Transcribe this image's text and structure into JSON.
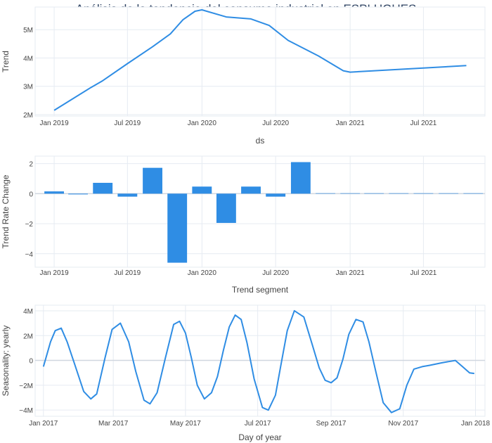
{
  "title": "Análisis de la tendencia del consumo industrial en ESPLUGUES",
  "colors": {
    "line": "#2f8de4",
    "bar": "#2f8de4",
    "grid": "#e6ebf2",
    "zeroline": "#d0d6df"
  },
  "chart_data": [
    {
      "type": "line",
      "name": "trend",
      "xlabel": "ds",
      "ylabel": "Trend",
      "x_ticks": [
        "Jan 2019",
        "Jul 2019",
        "Jan 2020",
        "Jul 2020",
        "Jan 2021",
        "Jul 2021"
      ],
      "y_ticks": [
        "2M",
        "3M",
        "4M",
        "5M"
      ],
      "xlim": [
        "2018-11-15",
        "2021-11-30"
      ],
      "ylim": [
        1950000,
        5800000
      ],
      "x": [
        "2019-01-01",
        "2019-04-01",
        "2019-05-01",
        "2019-07-01",
        "2019-09-01",
        "2019-10-15",
        "2019-11-15",
        "2019-12-15",
        "2020-01-01",
        "2020-03-01",
        "2020-05-01",
        "2020-06-15",
        "2020-08-01",
        "2020-10-15",
        "2020-12-15",
        "2021-01-01",
        "2021-10-15"
      ],
      "y": [
        2150000,
        2950000,
        3200000,
        3800000,
        4400000,
        4850000,
        5350000,
        5650000,
        5700000,
        5450000,
        5380000,
        5150000,
        4620000,
        4070000,
        3550000,
        3500000,
        3730000
      ],
      "grid": true
    },
    {
      "type": "bar",
      "name": "trend-rate-change",
      "xlabel": "Trend segment",
      "ylabel": "Trend Rate Change",
      "x_ticks": [
        "Jan 2019",
        "Jul 2019",
        "Jan 2020",
        "Jul 2020",
        "Jan 2021",
        "Jul 2021"
      ],
      "y_ticks": [
        "2",
        "0",
        "−2",
        "−4"
      ],
      "xlim": [
        "2018-11-15",
        "2021-11-30"
      ],
      "ylim": [
        -4.9,
        2.5
      ],
      "x": [
        "2019-01-01",
        "2019-03-01",
        "2019-05-01",
        "2019-07-01",
        "2019-09-01",
        "2019-11-01",
        "2020-01-01",
        "2020-03-01",
        "2020-05-01",
        "2020-07-01",
        "2020-09-01",
        "2020-11-01",
        "2021-01-01",
        "2021-03-01",
        "2021-05-01",
        "2021-07-01",
        "2021-09-01",
        "2021-11-01"
      ],
      "values": [
        0.15,
        -0.05,
        0.72,
        -0.2,
        1.72,
        -4.6,
        0.47,
        -1.95,
        0.47,
        -0.2,
        2.1,
        0,
        0,
        0,
        0,
        0,
        0,
        0
      ],
      "grid": true
    },
    {
      "type": "line",
      "name": "yearly-seasonality",
      "xlabel": "Day of year",
      "ylabel": "Seasonality: yearly",
      "x_ticks": [
        "Jan 2017",
        "Mar 2017",
        "May 2017",
        "Jul 2017",
        "Sep 2017",
        "Nov 2017",
        "Jan 2018"
      ],
      "y_ticks": [
        "4M",
        "2M",
        "0",
        "−2M",
        "−4M"
      ],
      "xlim": [
        -7,
        373
      ],
      "ylim": [
        -4500000,
        4450000
      ],
      "x": [
        0,
        6,
        10,
        15,
        20,
        26,
        34,
        40,
        45,
        52,
        58,
        65,
        72,
        78,
        85,
        90,
        96,
        103,
        110,
        115,
        120,
        125,
        130,
        136,
        142,
        147,
        152,
        157,
        162,
        167,
        172,
        178,
        185,
        190,
        196,
        200,
        206,
        212,
        220,
        227,
        233,
        238,
        243,
        248,
        253,
        258,
        264,
        270,
        275,
        281,
        287,
        294,
        301,
        307,
        313,
        320,
        326,
        331,
        336,
        342,
        348,
        354,
        360,
        364
      ],
      "y": [
        -500000,
        1500000,
        2400000,
        2600000,
        1500000,
        -200000,
        -2500000,
        -3100000,
        -2700000,
        200000,
        2500000,
        3000000,
        1500000,
        -900000,
        -3200000,
        -3500000,
        -2600000,
        200000,
        2900000,
        3150000,
        2200000,
        200000,
        -2000000,
        -3100000,
        -2600000,
        -1300000,
        800000,
        2700000,
        3650000,
        3300000,
        1400000,
        -1500000,
        -3800000,
        -4000000,
        -2800000,
        -700000,
        2400000,
        4000000,
        3500000,
        1300000,
        -600000,
        -1600000,
        -1800000,
        -1400000,
        100000,
        2100000,
        3300000,
        3100000,
        1500000,
        -1000000,
        -3400000,
        -4200000,
        -3900000,
        -2000000,
        -700000,
        -500000,
        -400000,
        -300000,
        -200000,
        -100000,
        0,
        -500000,
        -1000000,
        -1050000
      ],
      "grid": true
    }
  ]
}
